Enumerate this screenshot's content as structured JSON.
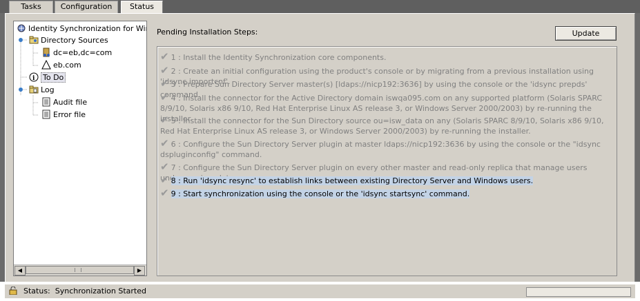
{
  "tabs": [
    "Tasks",
    "Configuration",
    "Status"
  ],
  "tree": {
    "root": "Identity Synchronization for Window",
    "directory_sources": "Directory Sources",
    "ds1": "dc=eb,dc=com",
    "ds2": "eb.com",
    "todo": "To Do",
    "log": "Log",
    "audit": "Audit file",
    "error": "Error file"
  },
  "pending_label": "Pending Installation Steps:",
  "update_label": "Update",
  "steps": [
    "1 : Install the Identity Synchronization core components.",
    "2 : Create an initial configuration using the product's console or by migrating from a previous installation using 'idsync importcnf'.",
    "3 : Prepare Sun Directory Server master(s) [ldaps://nicp192:3636] by using the console or the 'idsync prepds' command.",
    "4 : Install the connector for the Active Directory domain iswqa095.com on any supported platform (Solaris SPARC 8/9/10, Solaris x86 9/10, Red Hat Enterprise Linux AS release 3, or Windows Server 2000/2003) by re-running the installer.",
    "5 : Install the connector for the Sun Directory source ou=isw_data on any (Solaris SPARC 8/9/10, Solaris x86 9/10, Red Hat Enterprise Linux AS release 3, or Windows Server 2000/2003) by re-running the installer.",
    "6 : Configure the Sun Directory Server plugin at master ldaps://nicp192:3636 by using the console or the \"idsync dspluginconfig\" command.",
    "7 : Configure the Sun Directory Server plugin on every other master and read-only replica that manage users under ou=isw_data.",
    "8 : Run 'idsync resync' to establish links between existing Directory Server and Windows users.",
    "9 : Start synchronization using the console or the 'idsync startsync' command."
  ],
  "status": {
    "label": "Status:",
    "value": "Synchronization Started"
  }
}
